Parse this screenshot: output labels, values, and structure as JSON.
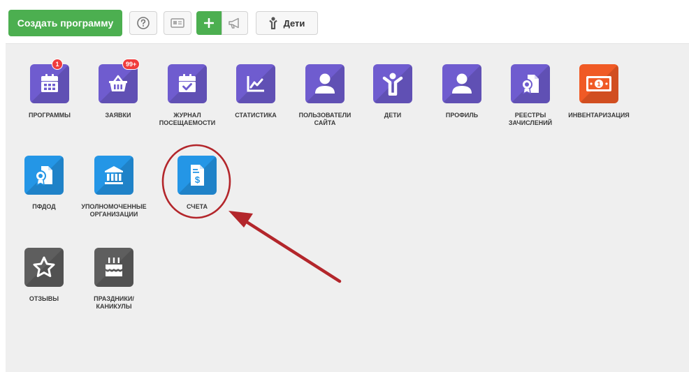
{
  "toolbar": {
    "create_program_label": "Создать программу",
    "children_label": "Дети",
    "colors": {
      "primary": "#4caf50"
    }
  },
  "tiles": [
    {
      "label": "ПРОГРАММЫ",
      "icon": "calendar-icon",
      "color": "#6f5ccf",
      "badge": "1"
    },
    {
      "label": "ЗАЯВКИ",
      "icon": "basket-icon",
      "color": "#6f5ccf",
      "badge": "99+"
    },
    {
      "label": "ЖУРНАЛ\nПОСЕЩАЕМОСТИ",
      "icon": "calendar-check-icon",
      "color": "#6f5ccf"
    },
    {
      "label": "СТАТИСТИКА",
      "icon": "chart-icon",
      "color": "#6f5ccf"
    },
    {
      "label": "ПОЛЬЗОВАТЕЛИ\nСАЙТА",
      "icon": "user-icon",
      "color": "#6f5ccf"
    },
    {
      "label": "ДЕТИ",
      "icon": "child-icon",
      "color": "#6f5ccf"
    },
    {
      "label": "ПРОФИЛЬ",
      "icon": "user-icon",
      "color": "#6f5ccf"
    },
    {
      "label": "РЕЕСТРЫ\nЗАЧИСЛЕНИЙ",
      "icon": "certificate-icon",
      "color": "#6f5ccf"
    },
    {
      "label": "ИНВЕНТАРИЗАЦИЯ",
      "icon": "inventory-icon",
      "color": "#f05a25"
    },
    {
      "label": "ПФДОД",
      "icon": "certificate-icon",
      "color": "#2496e6"
    },
    {
      "label": "УПОЛНОМОЧЕННЫЕ\nОРГАНИЗАЦИИ",
      "icon": "bank-icon",
      "color": "#2496e6"
    },
    {
      "label": "СЧЕТА",
      "icon": "invoice-icon",
      "color": "#2496e6"
    },
    {
      "label": "ОТЗЫВЫ",
      "icon": "star-icon",
      "color": "#5e5e5e"
    },
    {
      "label": "ПРАЗДНИКИ/\nКАНИКУЛЫ",
      "icon": "cake-icon",
      "color": "#5e5e5e"
    }
  ],
  "annotation": {
    "color": "#b3262b"
  }
}
